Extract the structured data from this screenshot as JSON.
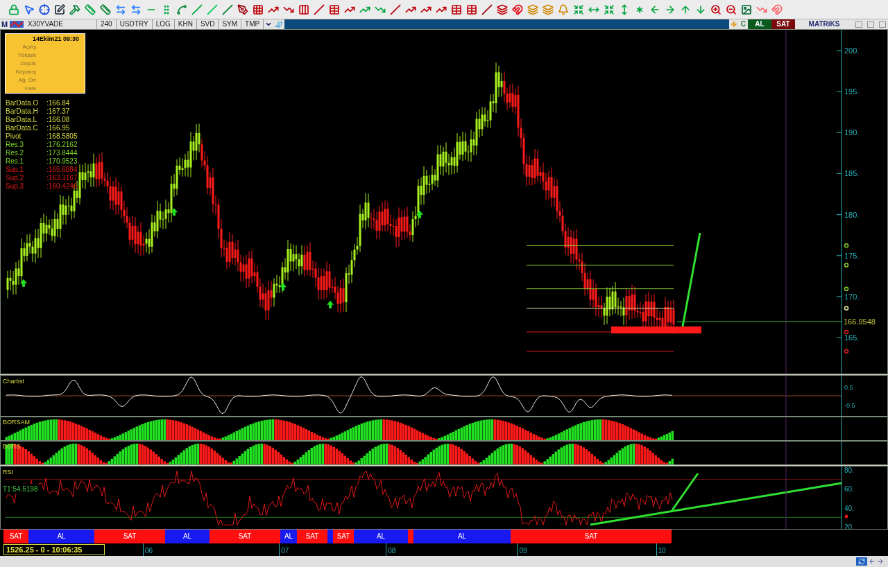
{
  "symbol_bar": {
    "menu_letter": "M",
    "items": [
      {
        "label": "X30YVADE"
      },
      {
        "label": "240"
      },
      {
        "label": "USDTRY"
      },
      {
        "label": "LOG"
      },
      {
        "label": "KHN"
      },
      {
        "label": "SVD"
      },
      {
        "label": "SYM"
      },
      {
        "label": "TMP"
      }
    ],
    "c_label": "C",
    "buy_label": "AL",
    "sell_label": "SAT",
    "brand": "MATRiKS"
  },
  "info_box": {
    "date": "14Ekim21 09:30",
    "labels": [
      "Açılış",
      "Yüksek",
      "Düşük",
      "Kapanış",
      "Ağ. Ort",
      "Fark"
    ]
  },
  "bar_data": [
    {
      "label": "BarData.O",
      "value": ":166.84",
      "kind": "data"
    },
    {
      "label": "BarData.H",
      "value": ":167.37",
      "kind": "data"
    },
    {
      "label": "BarData.L",
      "value": ":166.08",
      "kind": "data"
    },
    {
      "label": "BarData.C",
      "value": ":166.95",
      "kind": "data"
    },
    {
      "label": "Pivot",
      "value": ":168.5805",
      "kind": "pivot"
    },
    {
      "label": "Res.3",
      "value": ":176.2162",
      "kind": "resistance"
    },
    {
      "label": "Res.2",
      "value": ":173.8444",
      "kind": "resistance"
    },
    {
      "label": "Res.1",
      "value": ":170.9523",
      "kind": "resistance"
    },
    {
      "label": "Sup.1",
      "value": ":165.6884",
      "kind": "support"
    },
    {
      "label": "Sup.2",
      "value": ":163.3167",
      "kind": "support"
    },
    {
      "label": "Sup.3",
      "value": ":160.4246",
      "kind": "support"
    }
  ],
  "price_axis": {
    "ticks": [
      "200.",
      "195.",
      "190.",
      "185.",
      "180.",
      "175.",
      "170.",
      "165."
    ],
    "last_price": "166.9548"
  },
  "panels": [
    {
      "title": "Chartist",
      "ticks": [
        "0.5",
        "-0.5"
      ]
    },
    {
      "title": "BORSAM"
    },
    {
      "title": "BORS"
    }
  ],
  "rsi": {
    "title": "RSI",
    "value": "T1:54.5198",
    "ticks": [
      "80.",
      "60.",
      "40.",
      "20."
    ]
  },
  "signals": [
    {
      "label": "SAT",
      "kind": "sell"
    },
    {
      "label": "AL",
      "kind": "buy"
    },
    {
      "label": "SAT",
      "kind": "sell"
    },
    {
      "label": "AL",
      "kind": "buy"
    },
    {
      "label": "SAT",
      "kind": "sell"
    },
    {
      "label": "AL",
      "kind": "buy"
    },
    {
      "label": "SAT",
      "kind": "sell"
    },
    {
      "kind": "buy"
    },
    {
      "label": "SAT",
      "kind": "sell"
    },
    {
      "label": "AL",
      "kind": "buy"
    },
    {
      "kind": "sell"
    },
    {
      "label": "AL",
      "kind": "buy"
    },
    {
      "label": "SAT",
      "kind": "sell"
    }
  ],
  "status": {
    "readout": "1526.25 - 0 - 10:06:35",
    "dates": [
      "06",
      "07",
      "08",
      "09",
      "10"
    ]
  }
}
